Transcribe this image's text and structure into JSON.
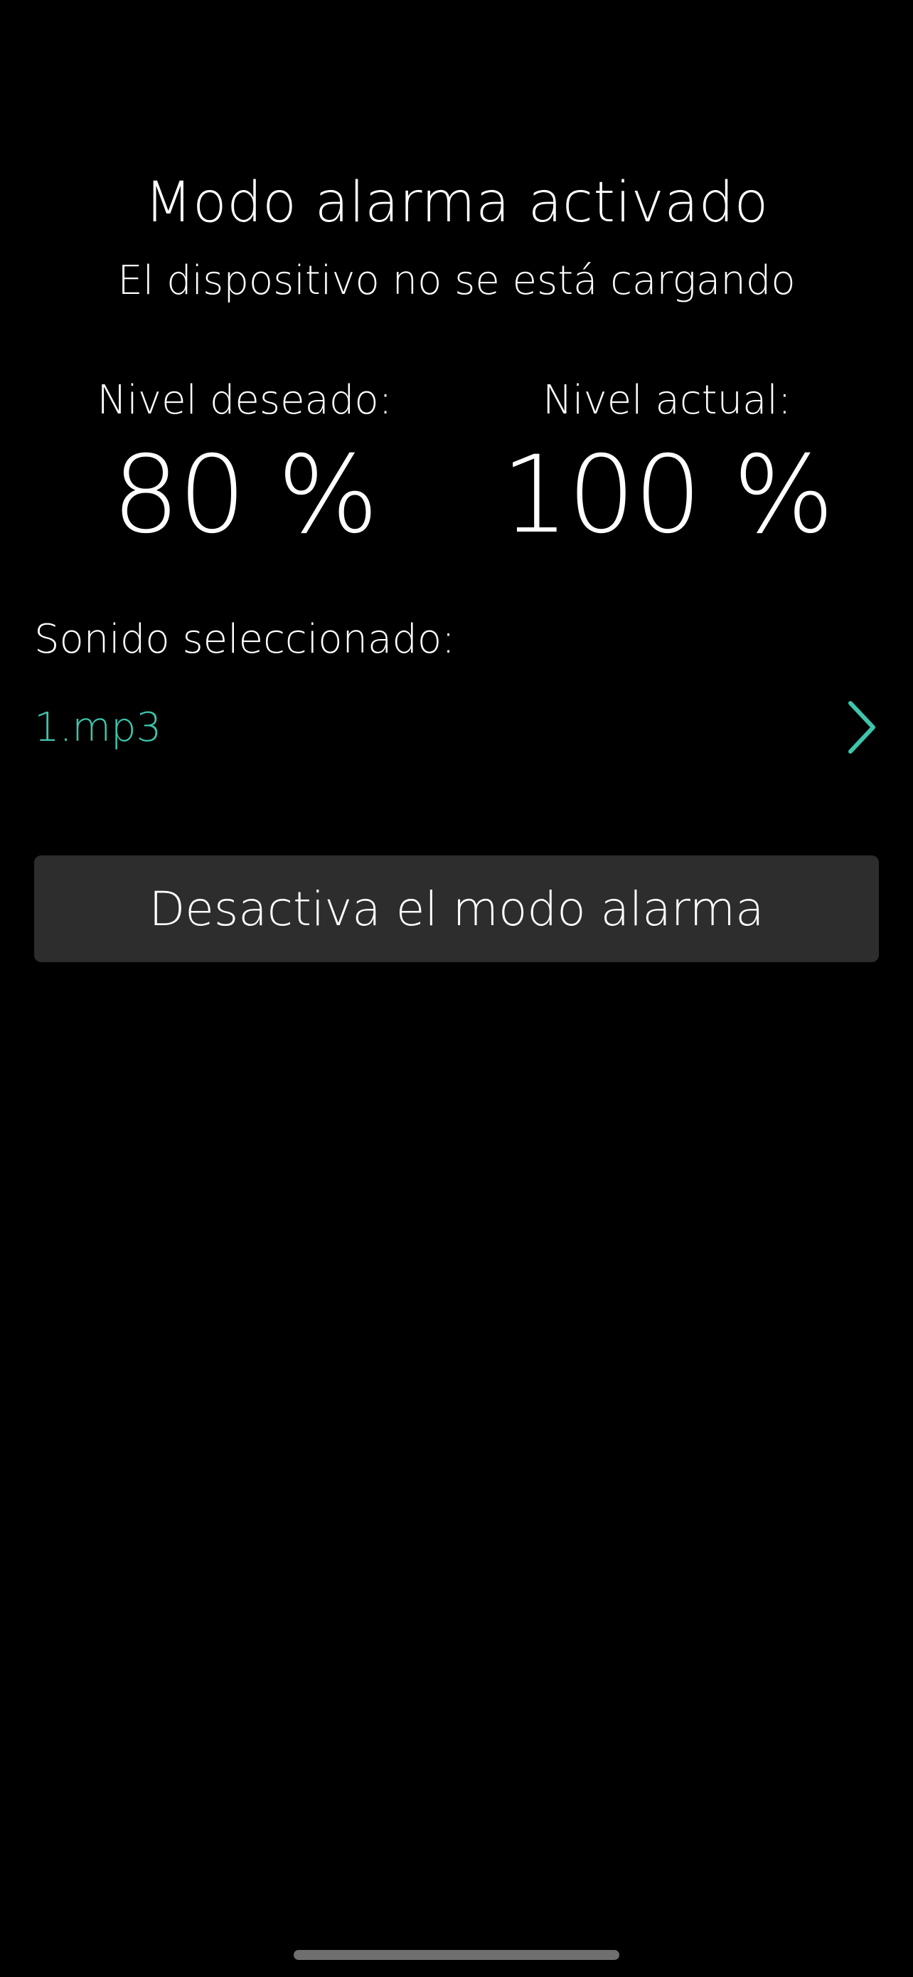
{
  "header": {
    "title": "Modo alarma activado",
    "subtitle": "El dispositivo no se está cargando"
  },
  "levels": {
    "desired": {
      "label": "Nivel deseado:",
      "value": "80 %",
      "percent": 80
    },
    "current": {
      "label": "Nivel actual:",
      "value": "100 %",
      "percent": 100
    }
  },
  "sound": {
    "label": "Sonido seleccionado:",
    "selected": "1.mp3",
    "chevron_icon": "chevron-right-icon"
  },
  "actions": {
    "deactivate_label": "Desactiva el modo alarma"
  },
  "colors": {
    "background": "#000000",
    "accent": "#3cc6ad",
    "button_bg": "#2d2d2d",
    "text": "#ffffff"
  }
}
